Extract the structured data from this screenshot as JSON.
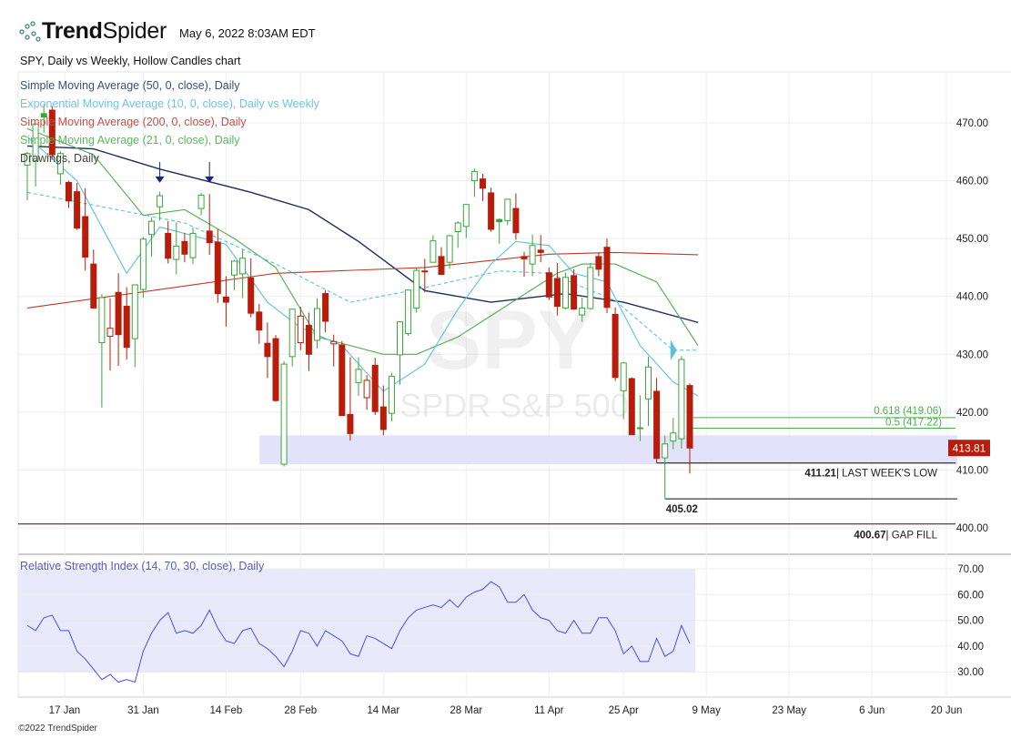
{
  "header": {
    "brand_bold": "Trend",
    "brand_light": "Spider",
    "timestamp": "May 6, 2022 8:03AM EDT",
    "chart_title": "SPY, Daily vs Weekly, Hollow Candles chart"
  },
  "legend": [
    {
      "label": "Simple Moving Average (50, 0, close), Daily",
      "color": "#3b4f7a"
    },
    {
      "label": "Exponential Moving Average (10, 0, close), Daily vs Weekly",
      "color": "#6cc6e0"
    },
    {
      "label": "Simple Moving Average (200, 0, close), Daily",
      "color": "#d04a4a"
    },
    {
      "label": "Simple Moving Average (21, 0, close), Daily",
      "color": "#5cb85c"
    },
    {
      "label": "Drawings, Daily",
      "color": "#444444"
    }
  ],
  "watermark": {
    "symbol": "SPY",
    "name": "SPDR S&P 500"
  },
  "rsi_label": "Relative Strength Index (14, 70, 30, close), Daily",
  "copyright": "©2022 TrendSpider",
  "chart_data": {
    "type": "candlestick",
    "symbol": "SPY",
    "ylim": [
      397,
      474
    ],
    "y_ticks": [
      400,
      410,
      420,
      430,
      440,
      450,
      460,
      470
    ],
    "x_ticks": [
      {
        "label": "17 Jan",
        "idx": 4.5
      },
      {
        "label": "31 Jan",
        "idx": 14
      },
      {
        "label": "14 Feb",
        "idx": 24
      },
      {
        "label": "28 Feb",
        "idx": 33
      },
      {
        "label": "14 Mar",
        "idx": 43
      },
      {
        "label": "28 Mar",
        "idx": 53
      },
      {
        "label": "11 Apr",
        "idx": 63
      },
      {
        "label": "25 Apr",
        "idx": 72
      },
      {
        "label": "9 May",
        "idx": 82
      },
      {
        "label": "23 May",
        "idx": 92
      },
      {
        "label": "6 Jun",
        "idx": 102
      },
      {
        "label": "20 Jun",
        "idx": 111
      }
    ],
    "candles": [
      [
        462.7,
        465.0,
        456.6,
        464.7
      ],
      [
        463.5,
        469.9,
        459.0,
        469.8
      ],
      [
        471.6,
        473.2,
        468.3,
        471.0
      ],
      [
        472.2,
        472.9,
        463.6,
        464.5
      ],
      [
        461.2,
        465.1,
        459.3,
        464.7
      ],
      [
        459.7,
        460.0,
        455.3,
        456.5
      ],
      [
        458.1,
        459.6,
        451.5,
        451.8
      ],
      [
        453.8,
        458.7,
        444.5,
        446.8
      ],
      [
        445.6,
        448.1,
        437.9,
        438.0
      ],
      [
        432.0,
        440.4,
        420.8,
        439.8
      ],
      [
        433.1,
        439.7,
        427.2,
        434.5
      ],
      [
        440.7,
        444.0,
        428.0,
        433.4
      ],
      [
        438.3,
        441.6,
        429.1,
        431.2
      ],
      [
        432.7,
        442.0,
        427.8,
        442.0
      ],
      [
        441.2,
        450.3,
        439.8,
        449.9
      ],
      [
        450.7,
        453.6,
        446.9,
        453.0
      ],
      [
        455.5,
        458.1,
        453.1,
        457.4
      ],
      [
        450.9,
        453.0,
        445.7,
        446.6
      ],
      [
        446.4,
        452.8,
        443.8,
        448.7
      ],
      [
        449.5,
        451.0,
        445.9,
        447.3
      ],
      [
        446.7,
        451.9,
        445.6,
        450.9
      ],
      [
        455.2,
        457.9,
        454.0,
        457.5
      ],
      [
        451.3,
        457.7,
        447.2,
        449.3
      ],
      [
        449.4,
        451.6,
        438.9,
        440.5
      ],
      [
        439.9,
        443.5,
        434.8,
        439.0
      ],
      [
        443.7,
        446.3,
        441.1,
        446.1
      ],
      [
        443.9,
        448.1,
        439.7,
        446.6
      ],
      [
        443.2,
        446.6,
        436.4,
        437.1
      ],
      [
        437.3,
        438.7,
        431.8,
        434.2
      ],
      [
        431.9,
        435.5,
        425.9,
        429.6
      ],
      [
        432.7,
        433.3,
        421.8,
        422.0
      ],
      [
        411.0,
        428.8,
        410.6,
        428.3
      ],
      [
        429.6,
        437.8,
        427.9,
        437.8
      ],
      [
        432.0,
        438.2,
        430.7,
        436.6
      ],
      [
        435.0,
        437.2,
        427.1,
        430.0
      ],
      [
        432.4,
        439.7,
        431.0,
        437.9
      ],
      [
        440.5,
        441.1,
        433.8,
        435.7
      ],
      [
        431.8,
        433.4,
        427.9,
        432.2
      ],
      [
        431.6,
        432.3,
        419.4,
        419.4
      ],
      [
        419.6,
        429.5,
        415.1,
        416.3
      ],
      [
        425.1,
        429.5,
        422.8,
        427.4
      ],
      [
        422.5,
        426.4,
        420.4,
        425.5
      ],
      [
        428.1,
        429.4,
        419.5,
        420.1
      ],
      [
        420.9,
        424.6,
        416.0,
        417.0
      ],
      [
        419.8,
        426.8,
        418.4,
        426.2
      ],
      [
        429.9,
        435.7,
        424.8,
        435.6
      ],
      [
        433.6,
        441.1,
        433.2,
        441.1
      ],
      [
        438.0,
        444.9,
        437.2,
        444.5
      ],
      [
        444.3,
        446.5,
        440.7,
        444.4
      ],
      [
        445.9,
        450.6,
        445.9,
        449.6
      ],
      [
        446.9,
        448.5,
        443.7,
        443.8
      ],
      [
        445.9,
        450.6,
        444.8,
        450.5
      ],
      [
        451.2,
        453.0,
        448.4,
        452.7
      ],
      [
        452.1,
        455.5,
        450.1,
        455.9
      ],
      [
        460.0,
        462.1,
        457.2,
        461.6
      ],
      [
        460.3,
        461.2,
        456.5,
        458.7
      ],
      [
        457.9,
        458.8,
        451.2,
        451.6
      ],
      [
        453.3,
        453.5,
        449.1,
        452.9
      ],
      [
        453.1,
        456.9,
        452.3,
        456.8
      ],
      [
        455.2,
        457.8,
        449.8,
        451.0
      ],
      [
        446.9,
        447.7,
        443.4,
        446.5
      ],
      [
        445.6,
        450.7,
        443.5,
        448.8
      ],
      [
        448.0,
        450.6,
        445.9,
        447.6
      ],
      [
        444.1,
        445.0,
        439.4,
        439.9
      ],
      [
        443.1,
        445.8,
        436.7,
        438.3
      ],
      [
        438.0,
        444.1,
        437.8,
        443.3
      ],
      [
        443.6,
        444.7,
        437.7,
        437.8
      ],
      [
        436.8,
        439.8,
        435.6,
        438.0
      ],
      [
        437.9,
        445.8,
        437.7,
        445.0
      ],
      [
        446.9,
        447.6,
        443.5,
        444.7
      ],
      [
        448.5,
        450.0,
        437.1,
        438.1
      ],
      [
        436.9,
        438.1,
        425.4,
        426.0
      ],
      [
        423.7,
        428.7,
        418.8,
        428.5
      ],
      [
        425.8,
        426.0,
        416.1,
        416.1
      ],
      [
        417.2,
        422.9,
        415.0,
        417.3
      ],
      [
        422.3,
        429.6,
        417.6,
        427.8
      ],
      [
        423.6,
        425.9,
        411.2,
        412.0
      ],
      [
        412.1,
        415.9,
        405.0,
        414.5
      ],
      [
        415.0,
        419.0,
        413.6,
        416.4
      ],
      [
        415.4,
        429.7,
        413.7,
        429.1
      ],
      [
        424.6,
        425.0,
        409.4,
        413.8
      ]
    ],
    "moving_averages": [
      {
        "name": "SMA 50",
        "color": "#1f2d5a",
        "dashed": false,
        "points": [
          [
            0,
            466
          ],
          [
            8,
            465.5
          ],
          [
            16,
            462
          ],
          [
            27,
            458
          ],
          [
            34,
            455
          ],
          [
            40,
            449.5
          ],
          [
            48,
            441
          ],
          [
            56,
            439
          ],
          [
            65,
            440.5
          ],
          [
            72,
            439
          ],
          [
            81,
            435.5
          ]
        ]
      },
      {
        "name": "SMA 200",
        "color": "#c0392b",
        "dashed": false,
        "points": [
          [
            0,
            438
          ],
          [
            13,
            440.6
          ],
          [
            30,
            444
          ],
          [
            48,
            445
          ],
          [
            63,
            447.3
          ],
          [
            71,
            447.6
          ],
          [
            81,
            447.2
          ]
        ]
      },
      {
        "name": "SMA 21",
        "color": "#4caf50",
        "dashed": false,
        "points": [
          [
            0,
            469
          ],
          [
            8,
            464.5
          ],
          [
            14,
            454
          ],
          [
            19,
            455
          ],
          [
            25,
            450
          ],
          [
            30,
            445
          ],
          [
            35,
            433
          ],
          [
            43,
            430
          ],
          [
            47,
            430
          ],
          [
            52,
            433
          ],
          [
            58,
            438.5
          ],
          [
            64,
            444
          ],
          [
            67,
            445.6
          ],
          [
            71,
            445.6
          ],
          [
            76,
            442.5
          ],
          [
            81,
            431.5
          ]
        ]
      },
      {
        "name": "EMA 10 Daily",
        "color": "#5bc0de",
        "dashed": false,
        "points": [
          [
            0,
            467.6
          ],
          [
            6,
            460
          ],
          [
            12,
            444
          ],
          [
            16,
            452
          ],
          [
            24,
            449
          ],
          [
            29,
            439
          ],
          [
            33,
            434.6
          ],
          [
            38,
            431.5
          ],
          [
            43,
            423.6
          ],
          [
            48,
            428.3
          ],
          [
            52,
            437.8
          ],
          [
            56,
            445.6
          ],
          [
            59,
            449.5
          ],
          [
            63,
            448.8
          ],
          [
            66,
            444
          ],
          [
            70,
            442.5
          ],
          [
            74,
            431.5
          ],
          [
            78,
            425.2
          ],
          [
            81,
            422.8
          ]
        ]
      },
      {
        "name": "EMA 10 Weekly",
        "color": "#5bc0de",
        "dashed": true,
        "points": [
          [
            0,
            458
          ],
          [
            8,
            455.8
          ],
          [
            19,
            452.7
          ],
          [
            30,
            445.6
          ],
          [
            39,
            439
          ],
          [
            47,
            441.2
          ],
          [
            57,
            444.4
          ],
          [
            63,
            444
          ],
          [
            71,
            439.3
          ],
          [
            78,
            430.7
          ],
          [
            81,
            430.7
          ]
        ]
      }
    ],
    "current_price": 413.81,
    "zone": [
      411,
      416
    ],
    "levels": [
      {
        "label": "0.618 (419.06)",
        "value": 419.06,
        "color": "#4caf50"
      },
      {
        "label": "0.5 (417.22)",
        "value": 417.22,
        "color": "#4caf50"
      },
      {
        "value": 411.21,
        "bold": "411.21",
        "label": "| LAST WEEK'S LOW",
        "color": "#111111"
      },
      {
        "value": 405.02,
        "bold": "405.02",
        "label": "",
        "color": "#111111"
      },
      {
        "value": 400.67,
        "bold": "400.67",
        "label": "| GAP FILL",
        "color": "#3a0a0a"
      }
    ],
    "markers": [
      {
        "idx": 16,
        "price": 462,
        "type": "down-arrow"
      },
      {
        "idx": 22,
        "price": 462,
        "type": "down-arrow"
      }
    ],
    "rsi": {
      "ylim": [
        25,
        72
      ],
      "y_ticks": [
        30,
        40,
        50,
        60,
        70
      ],
      "values": [
        48,
        46,
        51,
        52,
        46,
        46,
        38,
        35,
        31,
        27,
        29,
        26,
        27,
        26,
        38,
        45,
        50,
        53,
        45,
        46,
        45,
        48,
        54,
        47,
        42,
        41,
        46,
        47,
        41,
        39,
        36,
        32,
        38,
        46,
        45,
        40,
        46,
        44,
        42,
        37,
        36,
        44,
        43,
        41,
        39,
        46,
        51,
        54,
        55,
        56,
        55,
        58,
        55,
        59,
        61,
        62,
        65,
        63,
        57,
        57,
        60,
        54,
        51,
        50,
        46,
        45,
        50,
        45,
        45,
        51,
        51,
        46,
        37,
        40,
        34,
        34,
        43,
        36,
        38,
        48,
        41
      ]
    }
  }
}
